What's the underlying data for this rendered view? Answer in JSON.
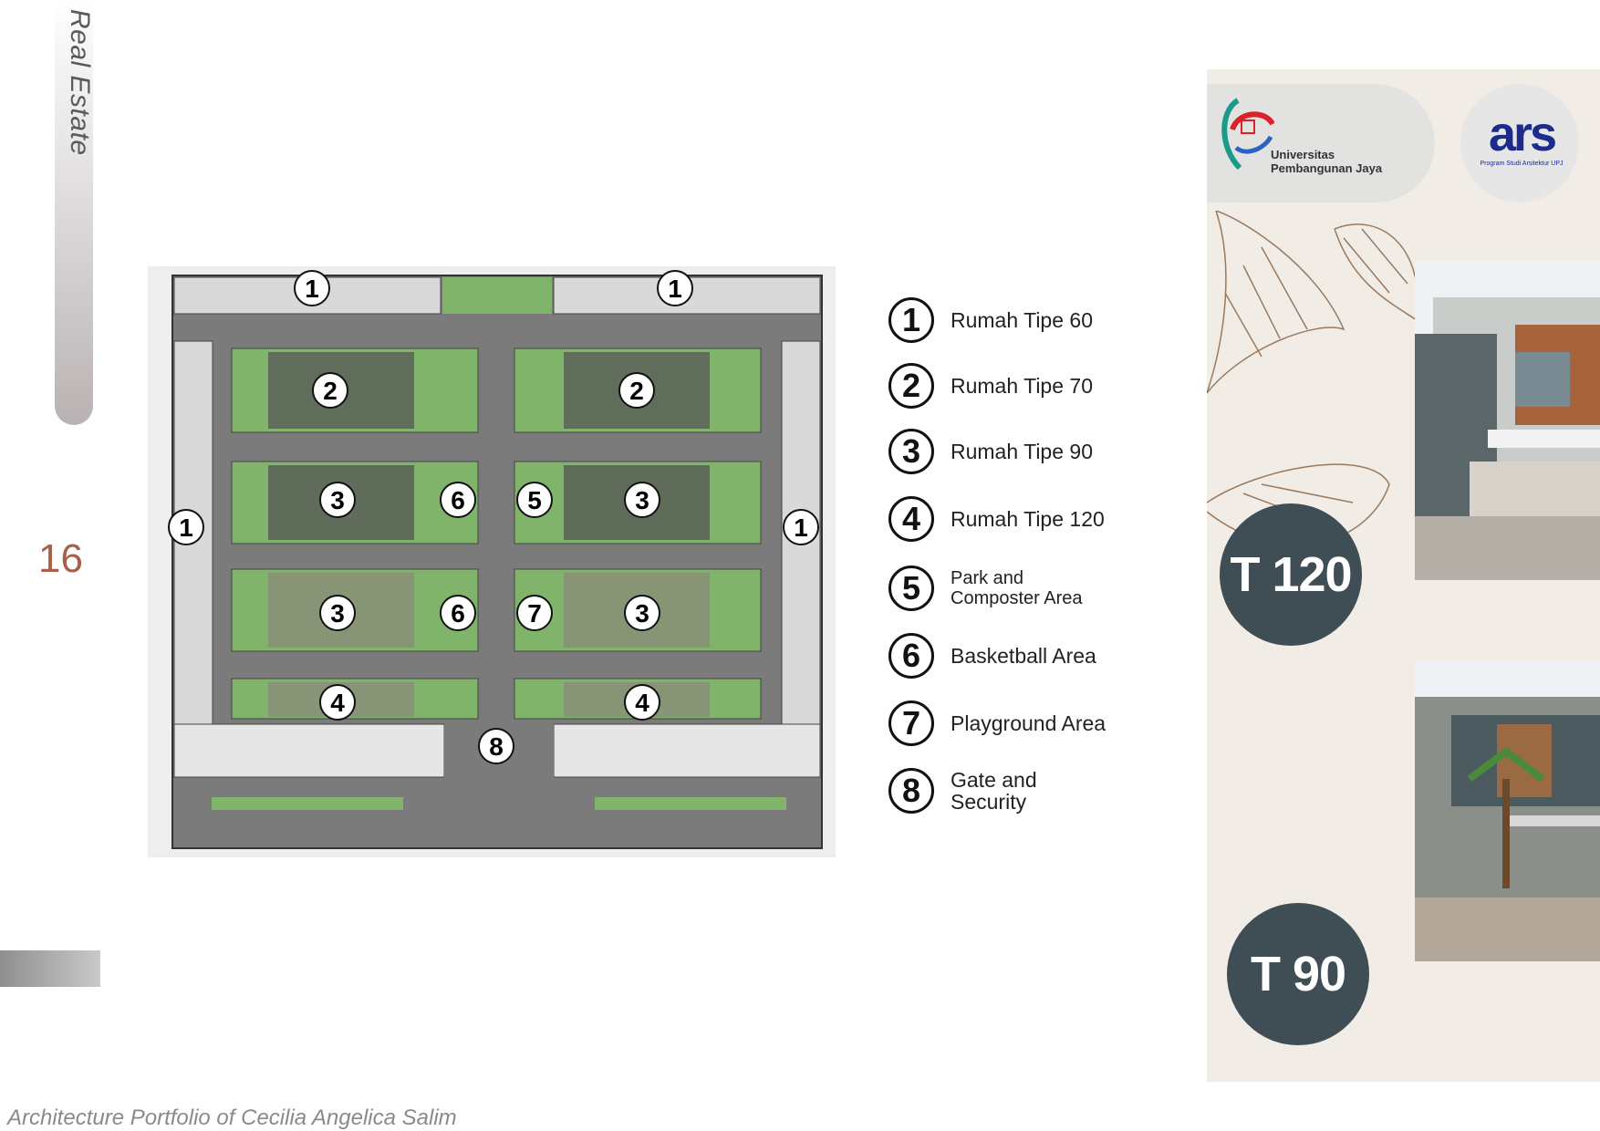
{
  "sidebar": {
    "section_title": "Real Estate",
    "page_number": "16"
  },
  "footer": {
    "text": "Architecture Portfolio of Cecilia Angelica Salim"
  },
  "siteplan": {
    "markers": [
      "1",
      "1",
      "1",
      "1",
      "2",
      "2",
      "3",
      "6",
      "5",
      "3",
      "3",
      "6",
      "7",
      "3",
      "4",
      "4",
      "8"
    ]
  },
  "legend": [
    {
      "num": "1",
      "label": "Rumah Tipe 60"
    },
    {
      "num": "2",
      "label": "Rumah Tipe 70"
    },
    {
      "num": "3",
      "label": "Rumah Tipe 90"
    },
    {
      "num": "4",
      "label": "Rumah Tipe 120"
    },
    {
      "num": "5",
      "label_line1": "Park and",
      "label_line2": "Composter Area"
    },
    {
      "num": "6",
      "label": "Basketball Area"
    },
    {
      "num": "7",
      "label": "Playground Area"
    },
    {
      "num": "8",
      "label_line1": "Gate and",
      "label_line2": "Security"
    }
  ],
  "logos": {
    "upj_line1": "Universitas",
    "upj_line2": "Pembangunan Jaya",
    "ars": "ars",
    "ars_sub": "Program Studi Arsitektur UPJ"
  },
  "badges": {
    "t120": "T 120",
    "t90": "T 90"
  },
  "colors": {
    "accent": "#a7614a",
    "badge": "#3f4d54",
    "panel": "#f2ece6",
    "road": "#7b7b7b",
    "green": "#7fb46a"
  }
}
